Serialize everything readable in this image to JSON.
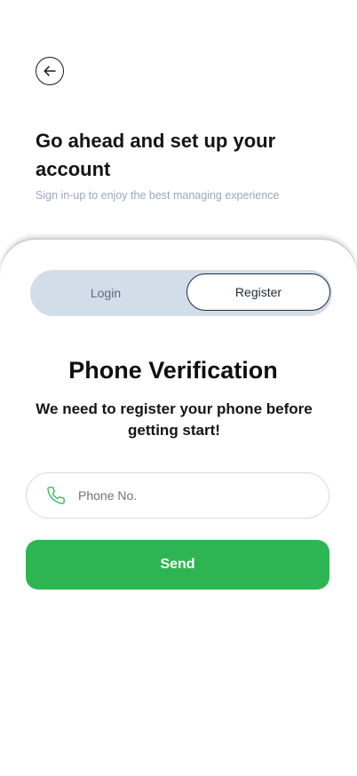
{
  "header": {
    "back_icon": "arrow-left-icon",
    "title": "Go ahead and set up your account",
    "subtitle": "Sign in-up to enjoy the best managing experience"
  },
  "tabs": {
    "login_label": "Login",
    "register_label": "Register",
    "active": "Register"
  },
  "verification": {
    "title": "Phone Verification",
    "description": "We need to register your phone before getting start!",
    "phone_icon": "phone-icon",
    "phone_placeholder": "Phone No.",
    "phone_value": "",
    "send_label": "Send"
  },
  "colors": {
    "accent_green": "#2eb553",
    "toggle_bg": "#d3dde9",
    "subtitle_text": "#9aa6c0"
  }
}
